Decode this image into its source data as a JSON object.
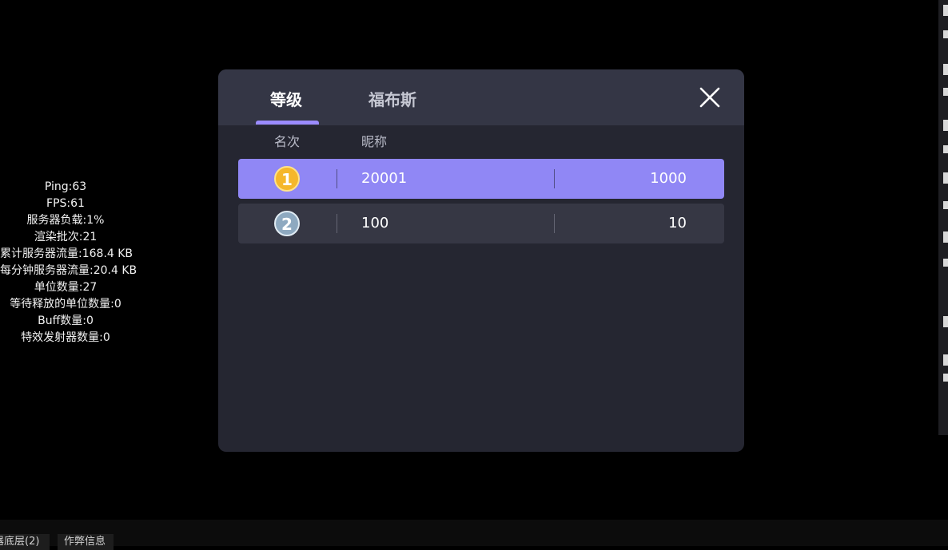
{
  "stats": [
    "Ping:63",
    "FPS:61",
    "服务器负载:1%",
    "渲染批次:21",
    "累计服务器流量:168.4 KB",
    "每分钟服务器流量:20.4 KB",
    "单位数量:27",
    "等待释放的单位数量:0",
    "Buff数量:0",
    "特效发射器数量:0"
  ],
  "bottom_tabs": [
    "器底层(2)",
    "作弊信息"
  ],
  "dialog": {
    "tabs": [
      {
        "label": "等级",
        "active": true
      },
      {
        "label": "福布斯",
        "active": false
      }
    ],
    "columns": {
      "rank": "名次",
      "nickname": "昵称"
    },
    "rows": [
      {
        "rank": "1",
        "medal": "gold",
        "nickname": "20001",
        "value": "1000",
        "highlighted": true
      },
      {
        "rank": "2",
        "medal": "silver",
        "nickname": "100",
        "value": "10",
        "highlighted": false
      }
    ],
    "close_icon": "close-icon"
  },
  "colors": {
    "accent": "#9b8bff",
    "highlight_row": "#9087f5",
    "gold": "#f5b72b",
    "silver": "#8ea9c0"
  }
}
